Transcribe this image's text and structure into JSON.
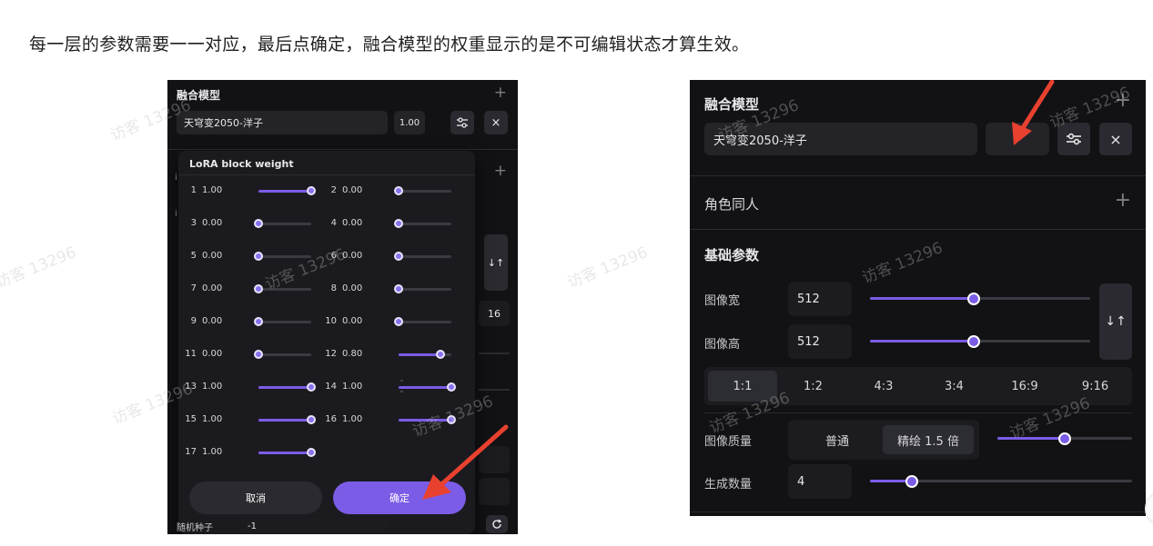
{
  "caption": "每一层的参数需要一一对应，最后点确定，融合模型的权重显示的是不可编辑状态才算生效。",
  "watermark": "访客 13296",
  "colors": {
    "accent": "#7b5ce6",
    "panel_bg": "#121215",
    "arrow": "#e8412f"
  },
  "left_panel": {
    "title": "融合模型",
    "model_name": "天穹变2050-洋子",
    "weight": "1.00",
    "icons": [
      "plus-icon",
      "sliders-icon",
      "close-icon",
      "swap-icon",
      "refresh-icon"
    ],
    "side_value": "16",
    "seed_label": "随机种子",
    "seed_value": "-1",
    "lora_popup": {
      "title": "LoRA block weight",
      "cancel_label": "取消",
      "confirm_label": "确定",
      "rows": [
        {
          "index": "1",
          "value": "1.00",
          "level": 1.0
        },
        {
          "index": "2",
          "value": "0.00",
          "level": 0.0
        },
        {
          "index": "3",
          "value": "0.00",
          "level": 0.0
        },
        {
          "index": "4",
          "value": "0.00",
          "level": 0.0
        },
        {
          "index": "5",
          "value": "0.00",
          "level": 0.0
        },
        {
          "index": "6",
          "value": "0.00",
          "level": 0.0
        },
        {
          "index": "7",
          "value": "0.00",
          "level": 0.0
        },
        {
          "index": "8",
          "value": "0.00",
          "level": 0.0
        },
        {
          "index": "9",
          "value": "0.00",
          "level": 0.0
        },
        {
          "index": "10",
          "value": "0.00",
          "level": 0.0
        },
        {
          "index": "11",
          "value": "0.00",
          "level": 0.0
        },
        {
          "index": "12",
          "value": "0.80",
          "level": 0.8
        },
        {
          "index": "13",
          "value": "1.00",
          "level": 1.0
        },
        {
          "index": "14",
          "value": "1.00",
          "level": 1.0
        },
        {
          "index": "15",
          "value": "1.00",
          "level": 1.0
        },
        {
          "index": "16",
          "value": "1.00",
          "level": 1.0
        },
        {
          "index": "17",
          "value": "1.00",
          "level": 1.0
        }
      ]
    }
  },
  "right_panel": {
    "title": "融合模型",
    "model_name": "天穹变2050-洋子",
    "role_section": "角色同人",
    "basic_section": "基础参数",
    "width_label": "图像宽",
    "width_value": "512",
    "width_level": 0.47,
    "height_label": "图像高",
    "height_value": "512",
    "height_level": 0.47,
    "ratios": [
      "1:1",
      "1:2",
      "4:3",
      "3:4",
      "16:9",
      "9:16"
    ],
    "selected_ratio": "1:1",
    "quality_label": "图像质量",
    "quality_options": [
      "普通",
      "精绘 1.5 倍"
    ],
    "selected_quality": "精绘 1.5 倍",
    "quality_level": 0.5,
    "count_label": "生成数量",
    "count_value": "4",
    "count_level": 0.16
  }
}
